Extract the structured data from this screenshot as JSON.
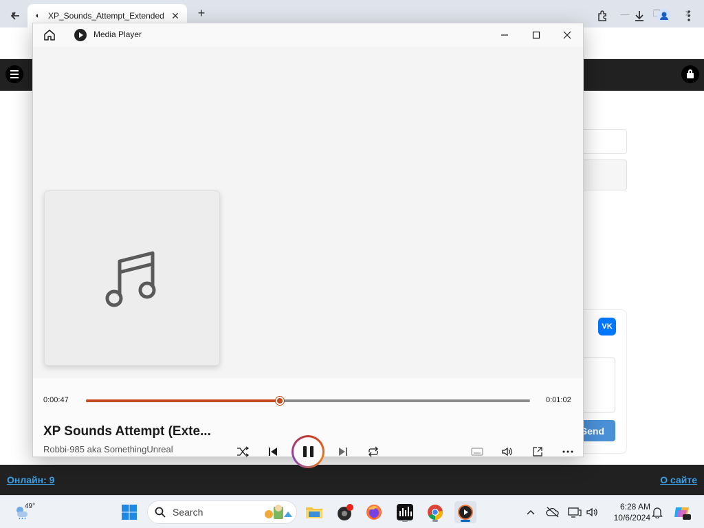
{
  "browser": {
    "tab_title": "XP_Sounds_Attempt_Extended",
    "close_tab": "✕",
    "new_tab": "+"
  },
  "site": {
    "send_label": "Send",
    "vk_label": "VK",
    "footer_left": "Онлайн: 9",
    "footer_right": "О сайте"
  },
  "player": {
    "app_title": "Media Player",
    "elapsed": "0:00:47",
    "total": "0:01:02",
    "progress": 0.436,
    "song_title": "XP Sounds Attempt (Exte...",
    "artist": "Robbi-985 aka SomethingUnreal",
    "accent_color": "#c44b1d"
  },
  "taskbar": {
    "weather_temp": "49°",
    "search_placeholder": "Search",
    "time": "6:28 AM",
    "date": "10/6/2024"
  }
}
